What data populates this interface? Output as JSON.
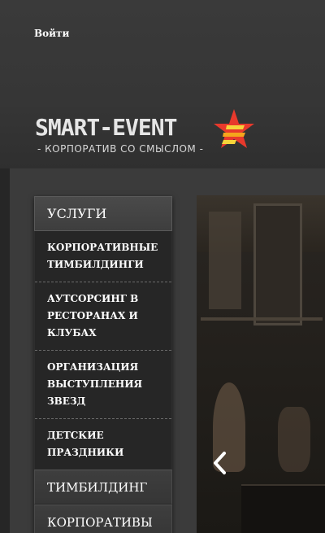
{
  "header": {
    "login_label": "Войти"
  },
  "logo": {
    "title": "SMART-EVENT",
    "subtitle": "- КОРПОРАТИВ СО СМЫСЛОМ -",
    "star_colors": [
      "#e8392c",
      "#f4a51c",
      "#f6d43a"
    ]
  },
  "menu": {
    "heading": "УСЛУГИ",
    "subitems": [
      {
        "label": "КОРПОРАТИВНЫЕ ТИМБИЛДИНГИ"
      },
      {
        "label": "АУТСОРСИНГ В РЕСТОРАНАХ И КЛУБАХ"
      },
      {
        "label": "ОРГАНИЗАЦИЯ ВЫСТУПЛЕНИЯ ЗВЕЗД"
      },
      {
        "label": "ДЕТСКИЕ ПРАЗДНИКИ"
      }
    ],
    "main_items": [
      {
        "label": "ТИМБИЛДИНГ"
      },
      {
        "label": "КОРПОРАТИВЫ"
      }
    ]
  },
  "slider": {
    "prev_icon": "chevron-left-icon"
  }
}
